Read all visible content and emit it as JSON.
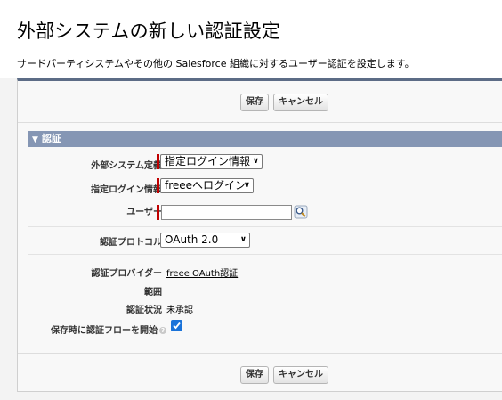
{
  "header": {
    "title": "外部システムの新しい認証設定",
    "description": "サードパーティシステムやその他の Salesforce 組織に対するユーザー認証を設定します。"
  },
  "buttons": {
    "save_label": "保存",
    "cancel_label": "キャンセル"
  },
  "section": {
    "title": "認証"
  },
  "fields": {
    "external_system": {
      "label": "外部システム定義",
      "value": "指定ログイン情報"
    },
    "named_credential": {
      "label": "指定ログイン情報",
      "value": "freeeへログイン"
    },
    "user": {
      "label": "ユーザー",
      "value": ""
    },
    "auth_protocol": {
      "label": "認証プロトコル",
      "value": "OAuth 2.0"
    },
    "auth_provider": {
      "label": "認証プロバイダー",
      "value": "freee OAuth認証"
    },
    "scope": {
      "label": "範囲",
      "value": ""
    },
    "auth_status": {
      "label": "認証状況",
      "value": "未承認"
    },
    "start_flow": {
      "label": "保存時に認証フローを開始",
      "checked": true
    }
  },
  "colors": {
    "section_header": "#8596b4",
    "required": "#c00000",
    "checkbox": "#1a73d9"
  },
  "icons": {
    "lookup": "lookup-icon",
    "help": "help-icon",
    "collapse": "collapse-triangle-icon"
  }
}
